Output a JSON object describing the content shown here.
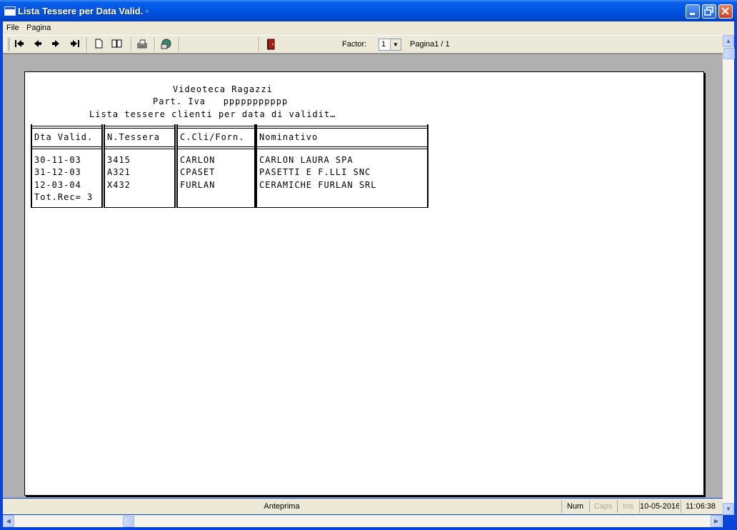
{
  "window": {
    "title": "Lista Tessere per Data Valid. ▫"
  },
  "menu": {
    "items": [
      "File",
      "Pagina"
    ]
  },
  "toolbar": {
    "factor_label": "Factor:",
    "factor_value": "1",
    "page_label": "Pagina1 / 1"
  },
  "report": {
    "company": "Videoteca Ragazzi",
    "vat": "Part. Iva   ppppppppppp",
    "heading": "Lista tessere clienti per data di validit…",
    "columns": [
      "Dta Valid.",
      "N.Tessera",
      "C.Cli/Forn.",
      "Nominativo"
    ],
    "rows": [
      [
        "30-11-03",
        "3415",
        "CARLON",
        "CARLON LAURA SPA"
      ],
      [
        "31-12-03",
        "A321",
        "CPASET",
        "PASETTI E F.LLI SNC"
      ],
      [
        "12-03-04",
        "X432",
        "FURLAN",
        "CERAMICHE FURLAN SRL"
      ]
    ],
    "total": "Tot.Rec= 3"
  },
  "status": {
    "main": "Anteprima",
    "num": "Num",
    "caps": "Caps",
    "ins": "Ins",
    "date": "10-05-2016",
    "time": "11:06:38"
  }
}
